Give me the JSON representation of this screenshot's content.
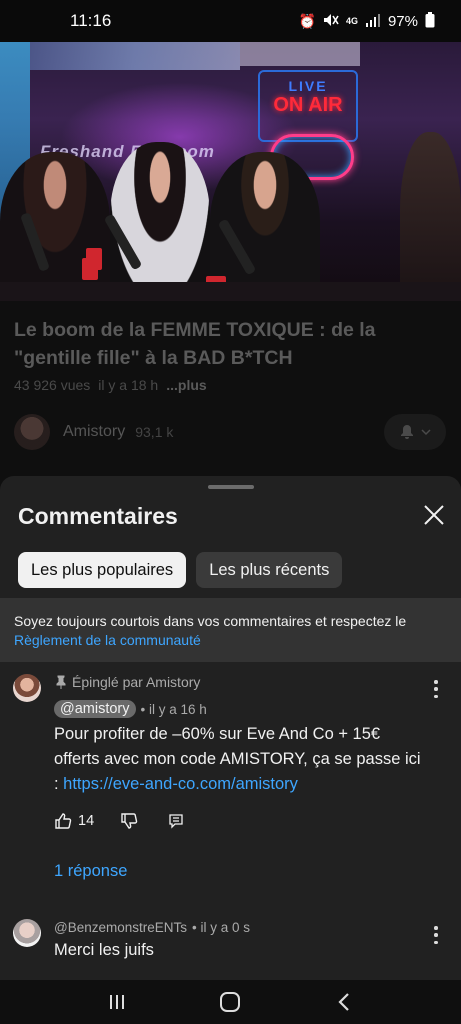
{
  "status_bar": {
    "time": "11:16",
    "battery": "97%",
    "network": "4G",
    "icons": [
      "alarm-icon",
      "mute-icon",
      "4g-icon",
      "signal-icon",
      "battery-icon"
    ]
  },
  "video": {
    "overlay_text_live": "LIVE",
    "overlay_text_onair": "ON AIR",
    "overlay_text_brand": "Freshand Fr... .com"
  },
  "video_info": {
    "title": "Le boom de la FEMME TOXIQUE : de la \"gentille fille\" à la BAD B*TCH",
    "views": "43 926 vues",
    "age": "il y a 18 h",
    "more": "...plus",
    "channel_name": "Amistory",
    "channel_subs": "93,1 k"
  },
  "comments_sheet": {
    "title": "Commentaires",
    "chips": [
      {
        "label": "Les plus populaires",
        "active": true
      },
      {
        "label": "Les plus récents",
        "active": false
      }
    ],
    "notice_text": "Soyez toujours courtois dans vos commentaires et respectez le",
    "notice_link": "Règlement de la communauté",
    "comments": [
      {
        "pinned_label": "Épinglé par Amistory",
        "author": "@amistory",
        "age": "• il y a 16 h",
        "text_main": "Pour profiter de –60% sur Eve And Co + 15€ offerts avec mon code AMISTORY, ça se passe ici : ",
        "text_link": "https://eve-and-co.com/amistory",
        "likes": "14",
        "replies_label": "1 réponse"
      },
      {
        "author": "@BenzemonstreENTs",
        "age": "• il y a 0 s",
        "text_main": "Merci les juifs"
      }
    ]
  },
  "colors": {
    "background": "#0f0f0f",
    "sheet": "#212121",
    "link": "#3ea6ff",
    "chip_active": "#f1f1f1",
    "chip_inactive": "#3a3a3a"
  }
}
